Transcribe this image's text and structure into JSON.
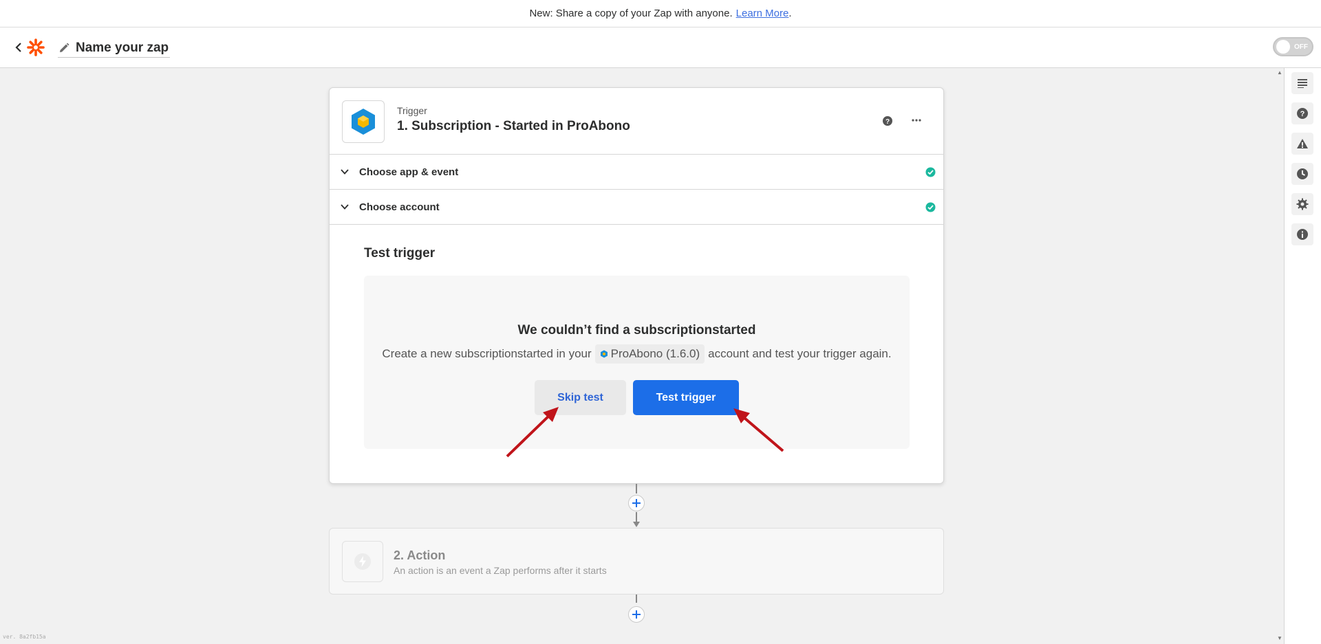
{
  "banner": {
    "text": "New: Share a copy of your Zap with anyone.",
    "link": "Learn More",
    "suffix": "."
  },
  "header": {
    "zap_name": "Name your zap",
    "toggle_label": "OFF"
  },
  "sidebar": {
    "items": [
      {
        "icon": "outline-icon"
      },
      {
        "icon": "help-icon"
      },
      {
        "icon": "warning-icon"
      },
      {
        "icon": "history-icon"
      },
      {
        "icon": "settings-icon"
      },
      {
        "icon": "info-icon"
      }
    ]
  },
  "trigger": {
    "kind": "Trigger",
    "title": "1. Subscription - Started in ProAbono",
    "sections": [
      {
        "label": "Choose app & event",
        "status": "complete"
      },
      {
        "label": "Choose account",
        "status": "complete"
      }
    ],
    "test": {
      "heading": "Test trigger",
      "empty_title": "We couldn’t find a subscriptionstarted",
      "desc_before": "Create a new subscriptionstarted in your",
      "app_chip": "ProAbono (1.6.0)",
      "desc_after": "account and test your trigger again.",
      "skip_label": "Skip test",
      "test_label": "Test trigger"
    }
  },
  "action": {
    "title": "2. Action",
    "desc": "An action is an event a Zap performs after it starts"
  },
  "version": "ver. 8a2fb15a",
  "colors": {
    "primary": "#1c6ee8",
    "success": "#1bb89e",
    "brand": "#ff4f00",
    "arrow": "#c0141a"
  }
}
